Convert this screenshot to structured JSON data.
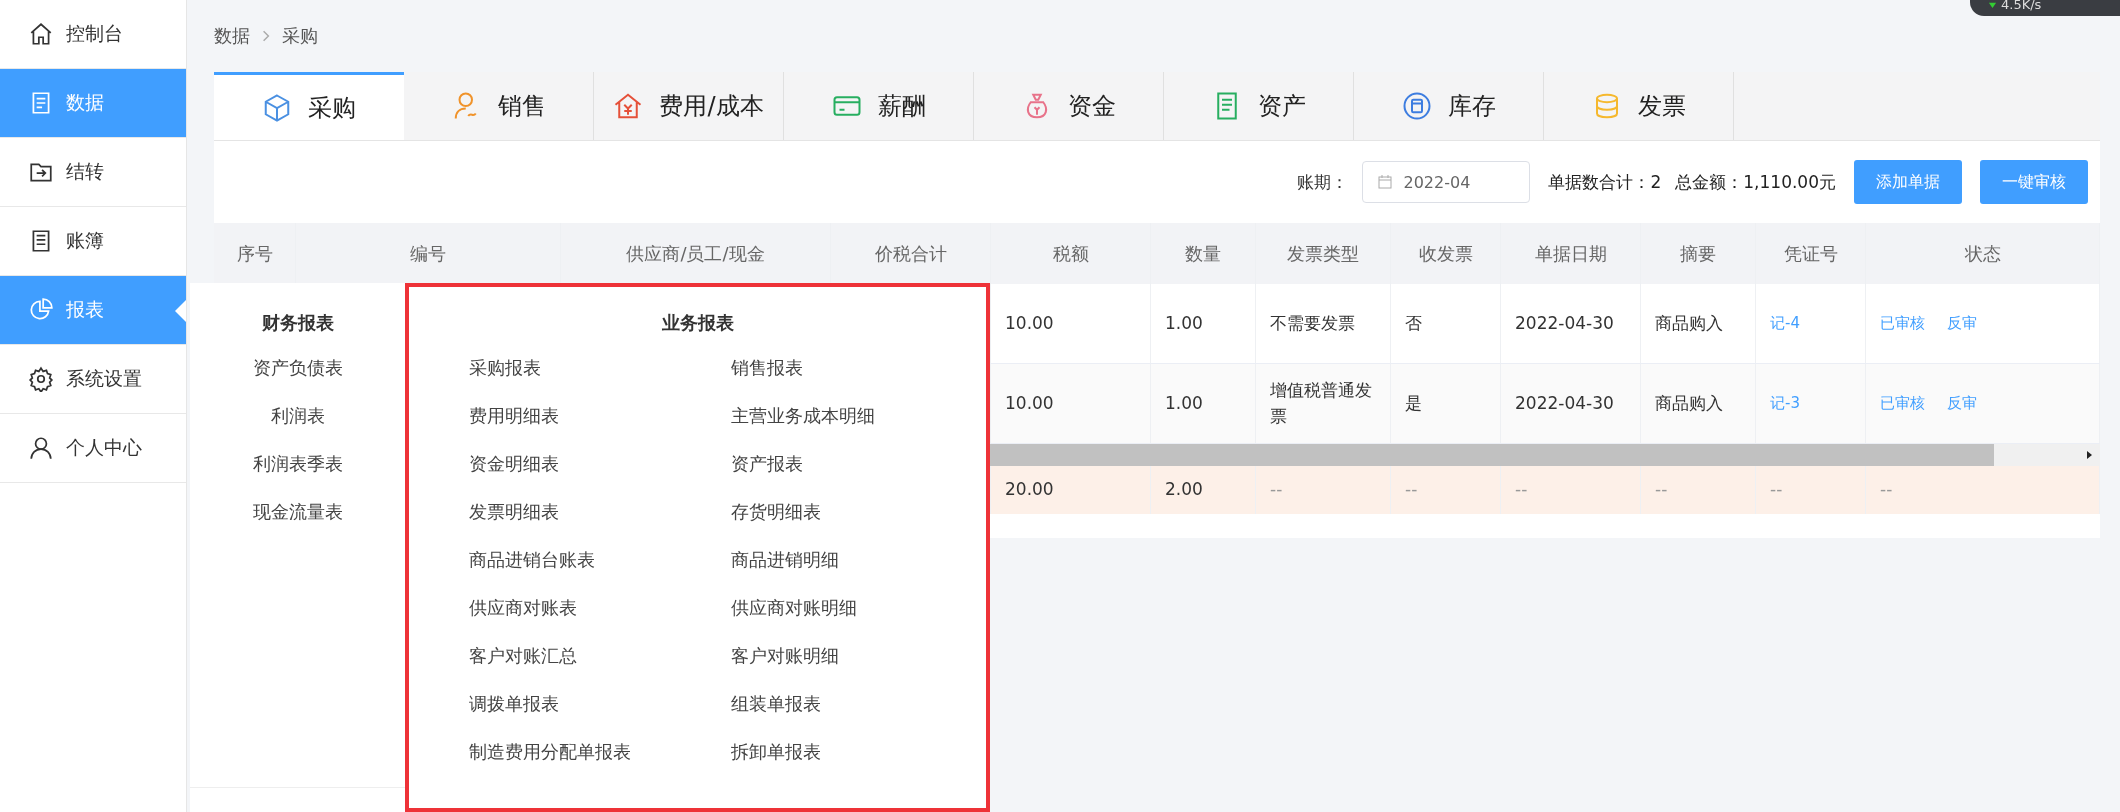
{
  "net_speed": "4.5K/s",
  "sidebar": {
    "items": [
      {
        "label": "控制台",
        "selected": false,
        "expanded": false
      },
      {
        "label": "数据",
        "selected": true,
        "expanded": false
      },
      {
        "label": "结转",
        "selected": false,
        "expanded": false
      },
      {
        "label": "账簿",
        "selected": false,
        "expanded": false
      },
      {
        "label": "报表",
        "selected": true,
        "expanded": true
      },
      {
        "label": "系统设置",
        "selected": false,
        "expanded": false
      },
      {
        "label": "个人中心",
        "selected": false,
        "expanded": false
      }
    ]
  },
  "breadcrumb": [
    "数据",
    "采购"
  ],
  "tabs": [
    {
      "label": "采购",
      "selected": true
    },
    {
      "label": "销售",
      "selected": false
    },
    {
      "label": "费用/成本",
      "selected": false
    },
    {
      "label": "薪酬",
      "selected": false
    },
    {
      "label": "资金",
      "selected": false
    },
    {
      "label": "资产",
      "selected": false
    },
    {
      "label": "库存",
      "selected": false
    },
    {
      "label": "发票",
      "selected": false
    }
  ],
  "toolbar": {
    "period_label": "账期：",
    "period": "2022-04",
    "count": "单据数合计：2",
    "total": "总金额：1,110.00元",
    "buttons": [
      "添加单据",
      "一键审核"
    ]
  },
  "table": {
    "columns": [
      "序号",
      "编号",
      "供应商/员工/现金",
      "价税合计",
      "税额",
      "数量",
      "发票类型",
      "收发票",
      "单据日期",
      "摘要",
      "凭证号",
      "状态"
    ],
    "rows": [
      {
        "cells": [
          "10.00",
          "1.00",
          "不需要发票",
          "否",
          "2022-04-30",
          "商品购入"
        ],
        "voucher": "记-4",
        "status": "已审核",
        "action": "反审"
      },
      {
        "cells": [
          "10.00",
          "1.00",
          "增值税普通发票",
          "是",
          "2022-04-30",
          "商品购入"
        ],
        "voucher": "记-3",
        "status": "已审核",
        "action": "反审"
      }
    ],
    "total_row": [
      "20.00",
      "2.00",
      "--",
      "--",
      "--",
      "--",
      "--",
      "--"
    ]
  },
  "report_menu": {
    "groups": [
      {
        "title": "财务报表",
        "items": [
          "资产负债表",
          "利润表",
          "利润表季表",
          "现金流量表"
        ]
      },
      {
        "title": "业务报表",
        "items": [
          "采购报表",
          "销售报表",
          "费用明细表",
          "主营业务成本明细",
          "资金明细表",
          "资产报表",
          "发票明细表",
          "存货明细表",
          "商品进销台账表",
          "商品进销明细",
          "供应商对账表",
          "供应商对账明细",
          "客户对账汇总",
          "客户对账明细",
          "调拨单报表",
          "组装单报表",
          "制造费用分配单报表",
          "拆卸单报表"
        ]
      }
    ]
  }
}
